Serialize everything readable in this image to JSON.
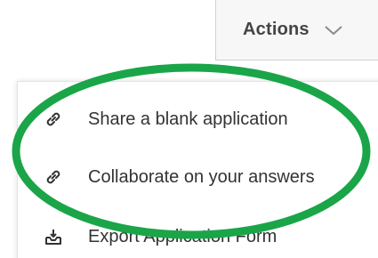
{
  "toolbar": {
    "actions_label": "Actions",
    "actions_icon": "chevron-down-icon"
  },
  "menu": {
    "items": [
      {
        "label": "Share a blank application",
        "icon": "link-icon"
      },
      {
        "label": "Collaborate on your answers",
        "icon": "link-icon"
      },
      {
        "label": "Export Application Form",
        "icon": "export-icon"
      }
    ]
  },
  "annotation": {
    "highlight_color": "#1aa548"
  }
}
